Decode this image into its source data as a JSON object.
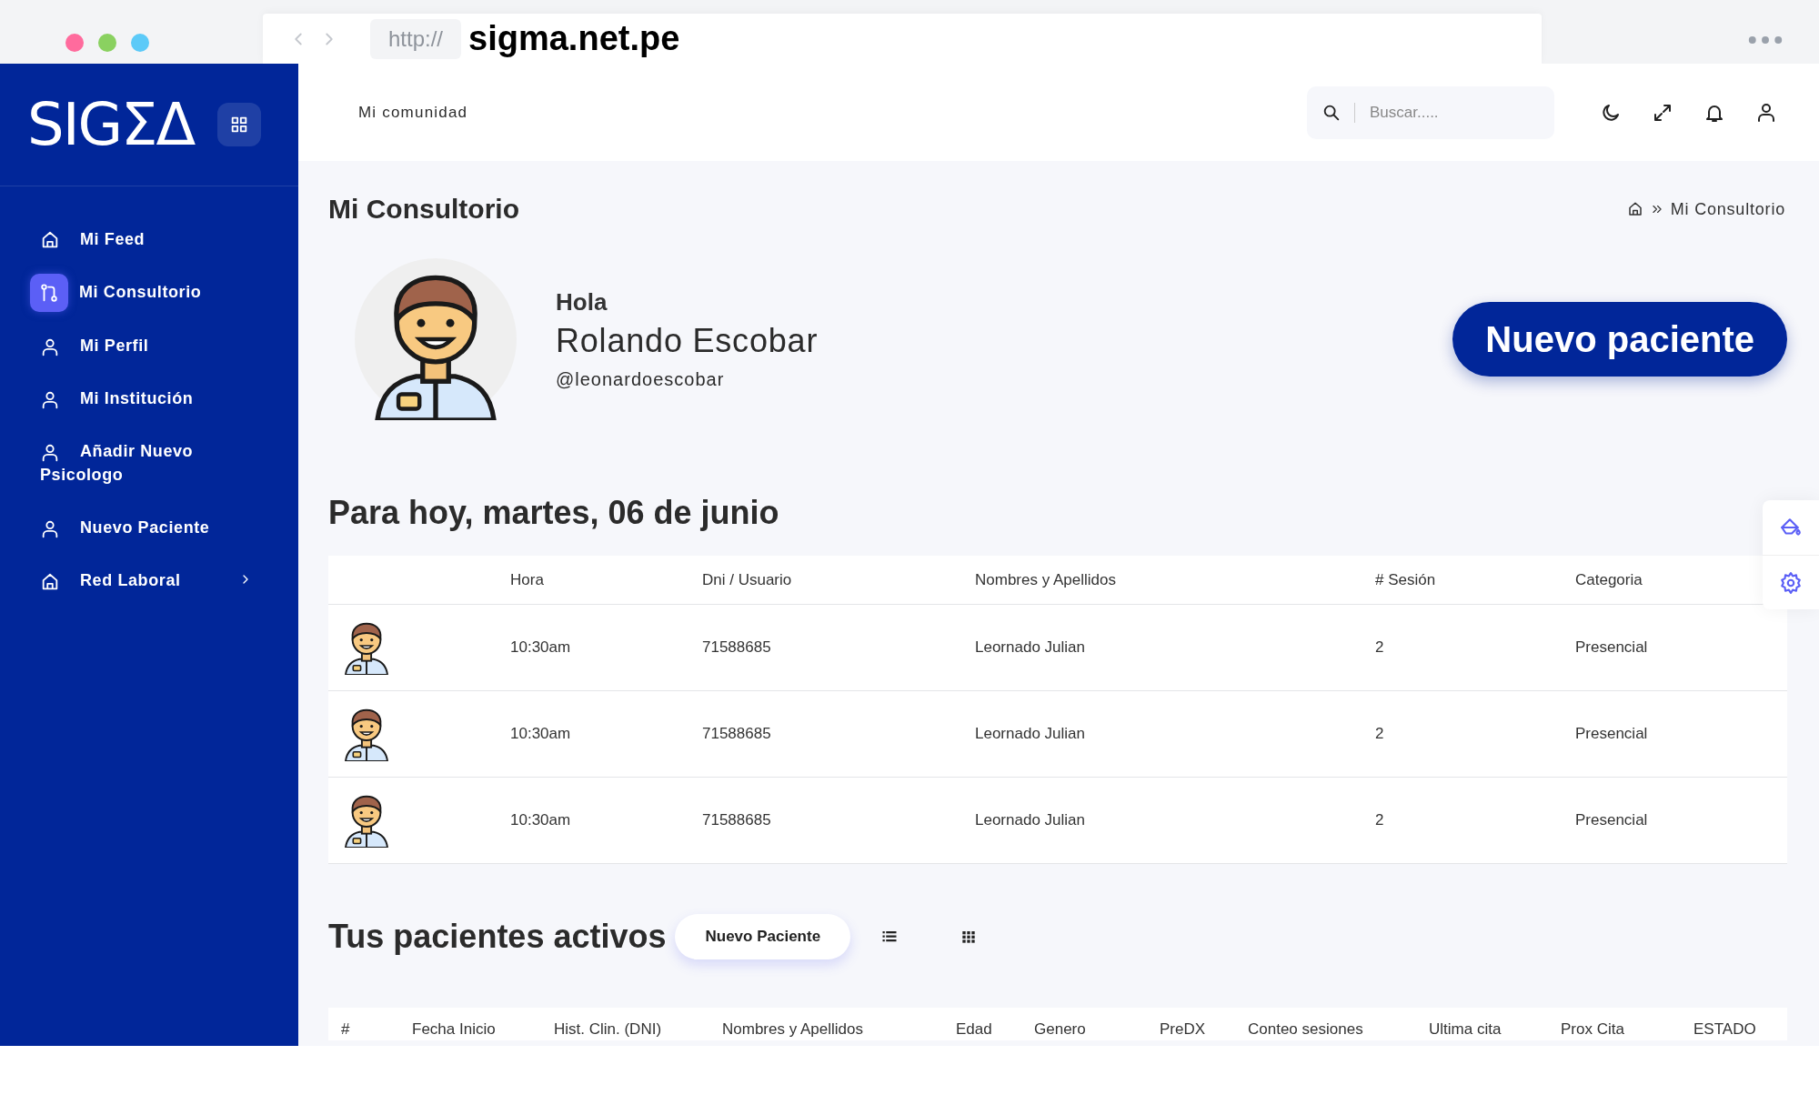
{
  "browser": {
    "scheme": "http://",
    "address": "sigma.net.pe"
  },
  "sidebar": {
    "logo": "SIGΣΔ",
    "items": [
      {
        "label": "Mi Feed",
        "kind": "home",
        "selected": false,
        "submenu": false
      },
      {
        "label": "Mi Consultorio",
        "kind": "consult",
        "selected": true,
        "submenu": false
      },
      {
        "label": "Mi Perfil",
        "kind": "user",
        "selected": false,
        "submenu": false
      },
      {
        "label": "Mi Institución",
        "kind": "user",
        "selected": false,
        "submenu": false
      },
      {
        "label": "Añadir Nuevo Psicologo",
        "kind": "user",
        "selected": false,
        "submenu": false
      },
      {
        "label": "Nuevo Paciente",
        "kind": "user",
        "selected": false,
        "submenu": false
      },
      {
        "label": "Red Laboral",
        "kind": "home",
        "selected": false,
        "submenu": true
      }
    ]
  },
  "header": {
    "link": "Mi comunidad",
    "search": {
      "placeholder": "Buscar....."
    }
  },
  "page": {
    "title": "Mi Consultorio",
    "breadcrumb": "Mi Consultorio"
  },
  "profile": {
    "greeting": "Hola",
    "name": "Rolando Escobar",
    "handle": "@leonardoescobar",
    "button": "Nuevo paciente"
  },
  "today": {
    "title": "Para hoy, martes, 06 de junio",
    "columns": [
      "Hora",
      "Dni / Usuario",
      "Nombres y Apellidos",
      "# Sesión",
      "Categoria"
    ],
    "rows": [
      {
        "hora": "10:30am",
        "dni": "71588685",
        "name": "Leornado Julian",
        "session": "2",
        "category": "Presencial"
      },
      {
        "hora": "10:30am",
        "dni": "71588685",
        "name": "Leornado Julian",
        "session": "2",
        "category": "Presencial"
      },
      {
        "hora": "10:30am",
        "dni": "71588685",
        "name": "Leornado Julian",
        "session": "2",
        "category": "Presencial"
      }
    ]
  },
  "active": {
    "title": "Tus pacientes activos",
    "button": "Nuevo Paciente",
    "columns": [
      "#",
      "Fecha Inicio",
      "Hist. Clin. (DNI)",
      "Nombres y Apellidos",
      "Edad",
      "Genero",
      "PreDX",
      "Conteo sesiones",
      "Ultima cita",
      "Prox Cita",
      "ESTADO"
    ]
  }
}
